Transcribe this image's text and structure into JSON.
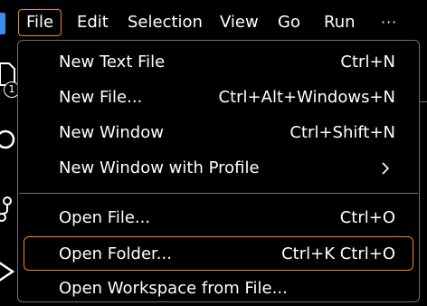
{
  "menubar": {
    "items": [
      "File",
      "Edit",
      "Selection",
      "View",
      "Go",
      "Run"
    ],
    "overflow": "···",
    "active": "File"
  },
  "activitybar": {
    "badge": "1",
    "icons": [
      "explorer-icon",
      "search-icon",
      "source-control-icon",
      "run-debug-icon"
    ]
  },
  "file_menu": {
    "items": [
      {
        "label": "New Text File",
        "shortcut": "Ctrl+N"
      },
      {
        "label": "New File...",
        "shortcut": "Ctrl+Alt+Windows+N"
      },
      {
        "label": "New Window",
        "shortcut": "Ctrl+Shift+N"
      },
      {
        "label": "New Window with Profile",
        "submenu": ">"
      },
      {
        "label": "Open File...",
        "shortcut": "Ctrl+O"
      },
      {
        "label": "Open Folder...",
        "shortcut": "Ctrl+K Ctrl+O"
      },
      {
        "label": "Open Workspace from File..."
      }
    ],
    "hovered": "Open Folder..."
  },
  "colors": {
    "background": "#000000",
    "text": "#ffffff",
    "focus_border": "#f38518",
    "menu_border": "#6f6f6f",
    "app_icon": "#3b8ee8"
  }
}
